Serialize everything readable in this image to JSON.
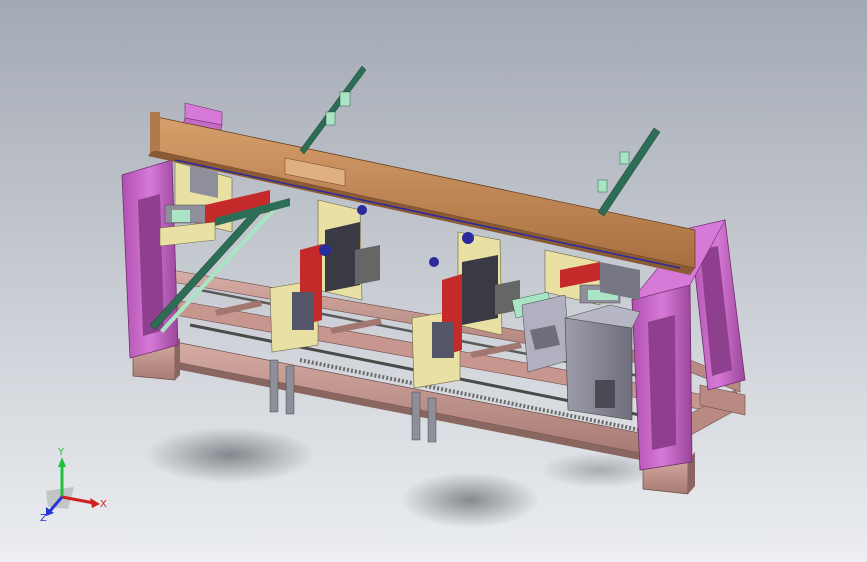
{
  "viewport": {
    "background_top": "#a3a9b4",
    "background_bottom": "#eceef1"
  },
  "colors": {
    "pink_frame": "#c964c9",
    "pink_frame_dark": "#8e3f8e",
    "base_rose": "#c99a93",
    "base_rose_dark": "#8a6660",
    "beam_tan": "#c88d5c",
    "beam_tan_dark": "#8a5a34",
    "rail_green": "#2d6d55",
    "rail_light": "#a9e4c4",
    "cart_yellow": "#e9e1a3",
    "motor_grey": "#8f8f9c",
    "accent_red": "#c52a2a",
    "accent_blue": "#2a2a9c"
  },
  "triad": {
    "icon": "coordinate-triad-icon",
    "x_label": "X",
    "y_label": "Y",
    "z_label": "Z",
    "x_color": "#d11e1e",
    "y_color": "#1ec23a",
    "z_color": "#2436d6"
  }
}
